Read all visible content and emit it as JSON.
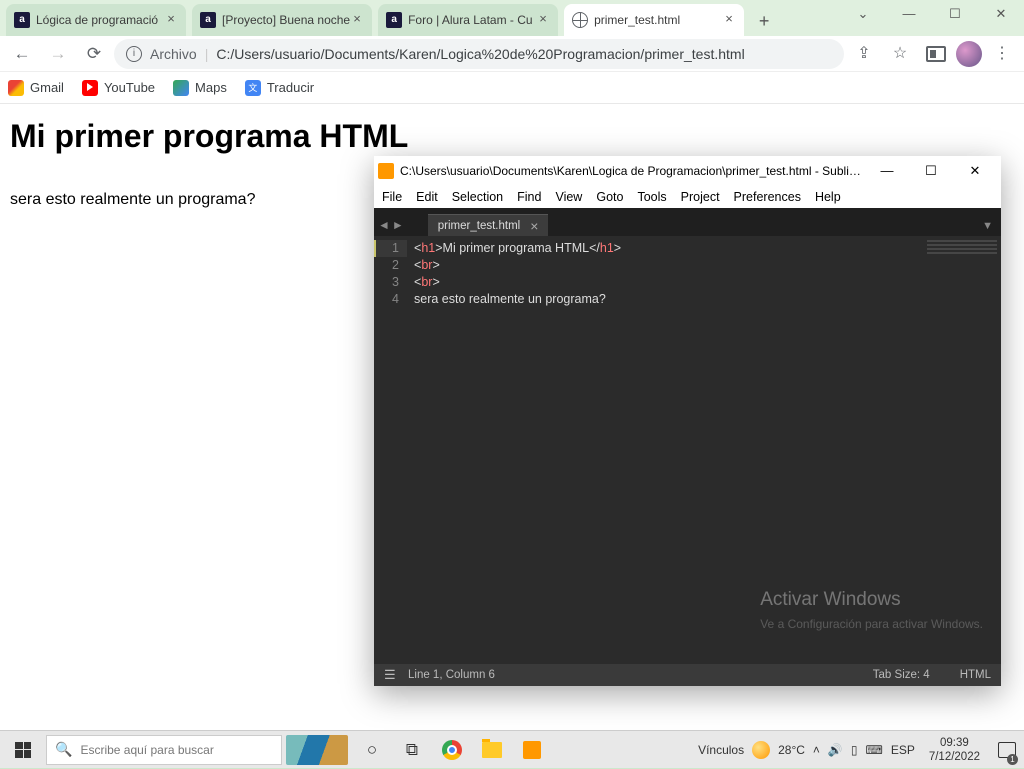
{
  "browser": {
    "tabs": [
      {
        "title": "Lógica de programació",
        "favicon": "alura"
      },
      {
        "title": "[Proyecto] Buena noche",
        "favicon": "alura"
      },
      {
        "title": "Foro | Alura Latam - Cu",
        "favicon": "alura"
      },
      {
        "title": "primer_test.html",
        "favicon": "globe",
        "active": true
      }
    ],
    "url_label": "Archivo",
    "url_path": "C:/Users/usuario/Documents/Karen/Logica%20de%20Programacion/primer_test.html",
    "bookmarks": [
      {
        "label": "Gmail",
        "icon": "gmail"
      },
      {
        "label": "YouTube",
        "icon": "youtube"
      },
      {
        "label": "Maps",
        "icon": "maps"
      },
      {
        "label": "Traducir",
        "icon": "translate"
      }
    ]
  },
  "page": {
    "heading": "Mi primer programa HTML",
    "paragraph": "sera esto realmente un programa?"
  },
  "sublime": {
    "title": "C:\\Users\\usuario\\Documents\\Karen\\Logica de Programacion\\primer_test.html - Sublim...",
    "menu": [
      "File",
      "Edit",
      "Selection",
      "Find",
      "View",
      "Goto",
      "Tools",
      "Project",
      "Preferences",
      "Help"
    ],
    "tab": "primer_test.html",
    "lines": {
      "l1_open": "h1",
      "l1_text": "Mi primer programa HTML",
      "l1_close": "h1",
      "l2": "br",
      "l3": "br",
      "l4": "sera esto realmente un programa?"
    },
    "gutter": [
      "1",
      "2",
      "3",
      "4"
    ],
    "watermark": "Activar Windows",
    "watermark_sub": "Ve a Configuración para activar Windows.",
    "status": {
      "pos": "Line 1, Column 6",
      "tab": "Tab Size: 4",
      "lang": "HTML"
    }
  },
  "taskbar": {
    "search_placeholder": "Escribe aquí para buscar",
    "links_label": "Vínculos",
    "temp": "28°C",
    "lang": "ESP",
    "time": "09:39",
    "date": "7/12/2022",
    "notif_count": "1"
  }
}
